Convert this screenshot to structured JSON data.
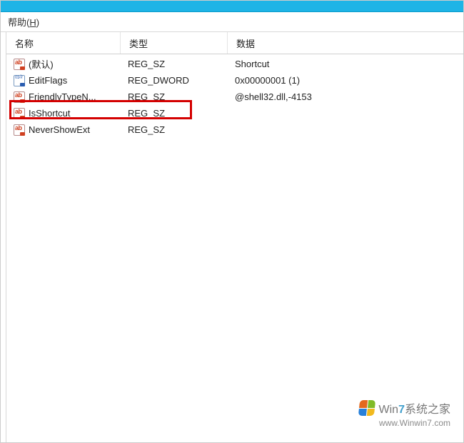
{
  "menubar": {
    "help_label": "帮助(",
    "help_underlined": "H",
    "help_suffix": ")"
  },
  "columns": {
    "name": "名称",
    "type": "类型",
    "data": "数据"
  },
  "rows": [
    {
      "icon": "str",
      "name": "(默认)",
      "type": "REG_SZ",
      "data": "Shortcut"
    },
    {
      "icon": "bin",
      "name": "EditFlags",
      "type": "REG_DWORD",
      "data": "0x00000001 (1)"
    },
    {
      "icon": "str",
      "name": "FriendlyTypeN...",
      "type": "REG_SZ",
      "data": "@shell32.dll,-4153"
    },
    {
      "icon": "str",
      "name": "IsShortcut",
      "type": "REG_SZ",
      "data": ""
    },
    {
      "icon": "str",
      "name": "NeverShowExt",
      "type": "REG_SZ",
      "data": ""
    }
  ],
  "highlight_row_index": 3,
  "watermark": {
    "brand_prefix": "Win",
    "brand_num": "7",
    "brand_suffix": "系统之家",
    "url": "www.Winwin7.com"
  }
}
